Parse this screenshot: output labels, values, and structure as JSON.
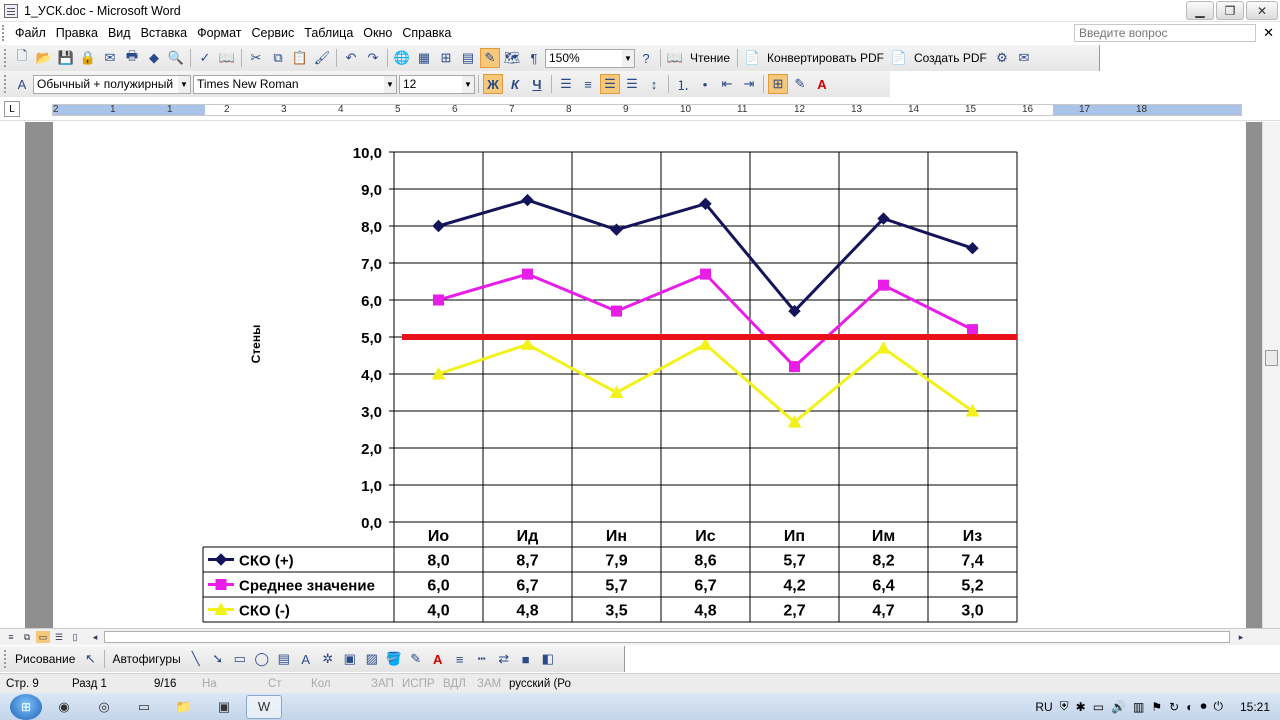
{
  "window": {
    "title": "1_УСК.doc - Microsoft Word"
  },
  "menu": {
    "items": [
      "Файл",
      "Правка",
      "Вид",
      "Вставка",
      "Формат",
      "Сервис",
      "Таблица",
      "Окно",
      "Справка"
    ],
    "ask_placeholder": "Введите вопрос"
  },
  "toolbar": {
    "zoom": "150%",
    "reading": "Чтение",
    "convert_pdf": "Конвертировать PDF",
    "create_pdf": "Создать PDF",
    "style": "Обычный + полужирный",
    "font": "Times New Roman",
    "size": "12",
    "bold": "Ж",
    "italic": "К",
    "underline": "Ч"
  },
  "ruler": {
    "numbers": [
      "2",
      "1",
      "1",
      "2",
      "3",
      "4",
      "5",
      "6",
      "7",
      "8",
      "9",
      "10",
      "11",
      "12",
      "13",
      "14",
      "15",
      "16",
      "17",
      "18"
    ]
  },
  "chart_data": {
    "type": "line",
    "title": "",
    "xlabel": "",
    "ylabel": "Стены",
    "ylim": [
      0,
      10
    ],
    "yticks": [
      "0,0",
      "1,0",
      "2,0",
      "3,0",
      "4,0",
      "5,0",
      "6,0",
      "7,0",
      "8,0",
      "9,0",
      "10,0"
    ],
    "categories": [
      "Ио",
      "Ид",
      "Ин",
      "Ис",
      "Ип",
      "Им",
      "Из"
    ],
    "series": [
      {
        "name": "СКО (+)",
        "values": [
          8.0,
          8.7,
          7.9,
          8.6,
          5.7,
          8.2,
          7.4
        ],
        "labels": [
          "8,0",
          "8,7",
          "7,9",
          "8,6",
          "5,7",
          "8,2",
          "7,4"
        ],
        "color": "#14145a",
        "marker": "diamond"
      },
      {
        "name": "Среднее значение",
        "values": [
          6.0,
          6.7,
          5.7,
          6.7,
          4.2,
          6.4,
          5.2
        ],
        "labels": [
          "6,0",
          "6,7",
          "5,7",
          "6,7",
          "4,2",
          "6,4",
          "5,2"
        ],
        "color": "#e81ee8",
        "marker": "square"
      },
      {
        "name": "СКО (-)",
        "values": [
          4.0,
          4.8,
          3.5,
          4.8,
          2.7,
          4.7,
          3.0
        ],
        "labels": [
          "4,0",
          "4,8",
          "3,5",
          "4,8",
          "2,7",
          "4,7",
          "3,0"
        ],
        "color": "#f2f21a",
        "marker": "triangle"
      }
    ],
    "reference_line": {
      "value": 5.0,
      "color": "#e8101a"
    },
    "grid": true,
    "data_table": true
  },
  "drawing": {
    "draw": "Рисование",
    "autoshapes": "Автофигуры"
  },
  "status": {
    "page": "Стр. 9",
    "section": "Разд 1",
    "pages": "9/16",
    "at": "На",
    "line": "Ст",
    "col": "Кол",
    "rec": "ЗАП",
    "trk": "ИСПР",
    "ext": "ВДЛ",
    "ovr": "ЗАМ",
    "lang": "русский (Ро"
  },
  "taskbar": {
    "lang": "RU",
    "time": "15:21"
  }
}
